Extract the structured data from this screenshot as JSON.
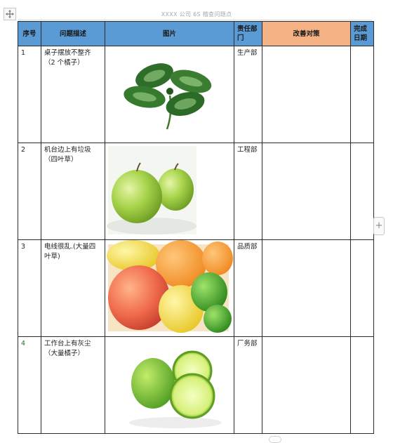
{
  "header": {
    "title": "XXXX 公司 6S 稽查问题点"
  },
  "table": {
    "columns": [
      {
        "label": "序号"
      },
      {
        "label": "问题描述"
      },
      {
        "label": "图片"
      },
      {
        "label": "责任部门"
      },
      {
        "label": "改善对策"
      },
      {
        "label": "完成日期"
      }
    ],
    "rows": [
      {
        "num": "1",
        "desc": "桌子摆放不整齐（2 个橘子）",
        "dept": "生产部",
        "measure": "",
        "date": "",
        "image": "four-leaf-clover"
      },
      {
        "num": "2",
        "desc": "机台边上有垃圾（四叶草）",
        "dept": "工程部",
        "measure": "",
        "date": "",
        "image": "green-apples"
      },
      {
        "num": "3",
        "desc": "电线很乱.(大量四叶草)",
        "dept": "品质部",
        "measure": "",
        "date": "",
        "image": "citrus-fruits"
      },
      {
        "num": "4",
        "desc": "工作台上有灰尘（大量橘子）",
        "dept": "厂务部",
        "measure": "",
        "date": "",
        "image": "limes"
      }
    ]
  },
  "colors": {
    "header_blue": "#5b9bd5",
    "header_orange": "#f4b183",
    "border": "#2b2b2b"
  },
  "icons": {
    "move_handle": "move-icon",
    "add_column": "plus-icon"
  },
  "controls": {
    "add_label": "+"
  }
}
